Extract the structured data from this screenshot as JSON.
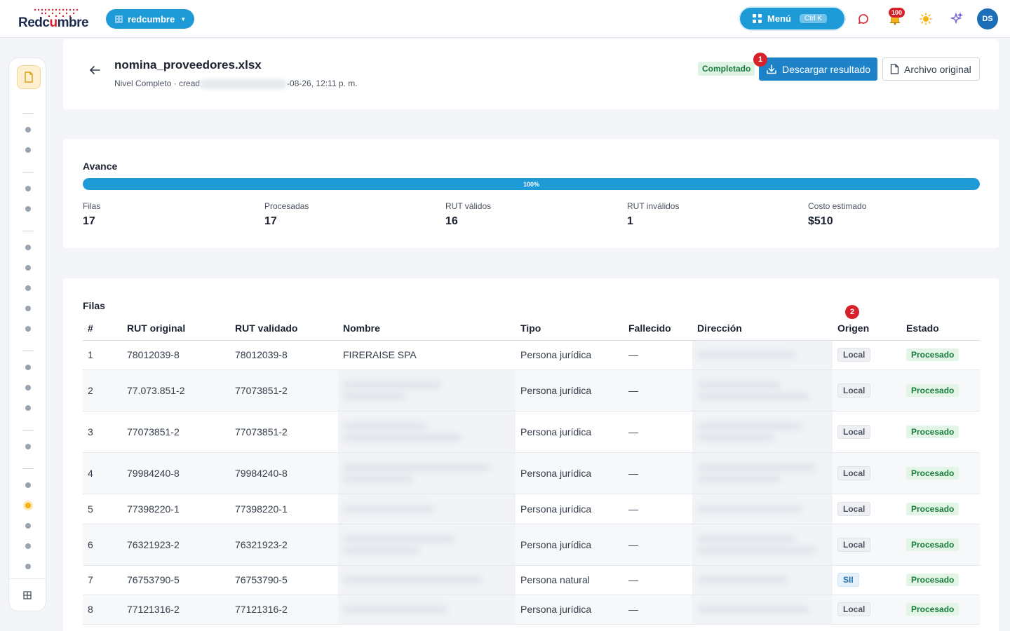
{
  "brand": {
    "logo_pre": "Redc",
    "logo_u": "u",
    "logo_post": "mbre",
    "org_name": "redcumbre"
  },
  "topbar": {
    "menu_label": "Menú",
    "menu_shortcut": "Ctrl K",
    "notifications_count": "100",
    "avatar_initials": "DS"
  },
  "file": {
    "name": "nomina_proveedores.xlsx",
    "meta_prefix": "Nivel Completo · cread",
    "meta_suffix": "-08-26, 12:11 p. m.",
    "status": "Completado",
    "download_label": "Descargar resultado",
    "download_step": "1",
    "original_label": "Archivo original"
  },
  "progress": {
    "title": "Avance",
    "percent_value": 100,
    "percent_label": "100%",
    "stats": [
      {
        "label": "Filas",
        "value": "17"
      },
      {
        "label": "Procesadas",
        "value": "17"
      },
      {
        "label": "RUT válidos",
        "value": "16"
      },
      {
        "label": "RUT inválidos",
        "value": "1"
      },
      {
        "label": "Costo estimado",
        "value": "$510"
      }
    ]
  },
  "rows_section": {
    "title": "Filas",
    "origin_step": "2",
    "columns": [
      "#",
      "RUT original",
      "RUT validado",
      "Nombre",
      "Tipo",
      "Fallecido",
      "Dirección",
      "Origen",
      "Estado"
    ],
    "rows": [
      {
        "n": "1",
        "rut_original": "78012039-8",
        "rut_validado": "78012039-8",
        "nombre": "FIRERAISE SPA",
        "tipo": "Persona jurídica",
        "fallecido": "—",
        "origen": "Local",
        "estado": "Procesado"
      },
      {
        "n": "2",
        "rut_original": "77.073.851-2",
        "rut_validado": "77073851-2",
        "nombre": "",
        "tipo": "Persona jurídica",
        "fallecido": "—",
        "origen": "Local",
        "estado": "Procesado"
      },
      {
        "n": "3",
        "rut_original": "77073851-2",
        "rut_validado": "77073851-2",
        "nombre": "",
        "tipo": "Persona jurídica",
        "fallecido": "—",
        "origen": "Local",
        "estado": "Procesado"
      },
      {
        "n": "4",
        "rut_original": "79984240-8",
        "rut_validado": "79984240-8",
        "nombre": "",
        "tipo": "Persona jurídica",
        "fallecido": "—",
        "origen": "Local",
        "estado": "Procesado"
      },
      {
        "n": "5",
        "rut_original": "77398220-1",
        "rut_validado": "77398220-1",
        "nombre": "",
        "tipo": "Persona jurídica",
        "fallecido": "—",
        "origen": "Local",
        "estado": "Procesado"
      },
      {
        "n": "6",
        "rut_original": "76321923-2",
        "rut_validado": "76321923-2",
        "nombre": "",
        "tipo": "Persona jurídica",
        "fallecido": "—",
        "origen": "Local",
        "estado": "Procesado"
      },
      {
        "n": "7",
        "rut_original": "76753790-5",
        "rut_validado": "76753790-5",
        "nombre": "",
        "tipo": "Persona natural",
        "fallecido": "—",
        "origen": "SII",
        "estado": "Procesado"
      },
      {
        "n": "8",
        "rut_original": "77121316-2",
        "rut_validado": "77121316-2",
        "nombre": "",
        "tipo": "Persona jurídica",
        "fallecido": "—",
        "origen": "Local",
        "estado": "Procesado"
      }
    ]
  },
  "colors": {
    "brand_blue": "#1e9bd7",
    "action_blue": "#1e82c8",
    "alert_red": "#d6212b",
    "success_green": "#1a7a3a",
    "active_yellow": "#f5b318"
  }
}
